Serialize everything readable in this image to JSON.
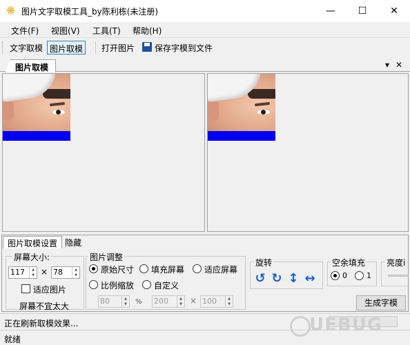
{
  "window": {
    "title": "图片文字取模工具_by陈利栋(未注册)",
    "minimize": "—",
    "maximize": "☐",
    "close": "✕"
  },
  "menu": [
    "文件(F)",
    "视图(V)",
    "工具(T)",
    "帮助(H)"
  ],
  "toolbar": {
    "text_mode": "文字取模",
    "image_mode": "图片取模",
    "open_image": "打开图片",
    "save_to_file": "保存字模到文件"
  },
  "doc_tab": {
    "label": "图片取模",
    "dropdown": "▾",
    "close": "✕"
  },
  "settings_tabs": [
    "图片取模设置",
    "隐藏"
  ],
  "screen_size": {
    "label": "屏幕大小:",
    "width": "117",
    "times": "×",
    "height": "78",
    "fit_image": "适应图片",
    "warning": "屏幕不宜太大"
  },
  "image_adjust": {
    "label": "图片调整",
    "original": "原始尺寸",
    "fill_screen": "填充屏幕",
    "fit_screen": "适应屏幕",
    "scale": "比例缩放",
    "custom": "自定义",
    "scale_value": "80",
    "percent": "%",
    "custom_w": "200",
    "times": "×",
    "custom_h": "100"
  },
  "rotate": {
    "label": "旋转",
    "ccw": "↺",
    "cw": "↻",
    "flip_v": "↕",
    "flip_h": "↔"
  },
  "fill": {
    "label": "空余填充",
    "opt0": "0",
    "opt1": "1"
  },
  "brightness": {
    "label": "亮度i"
  },
  "generate_button": "生成字模",
  "status": {
    "progress": "正在刷新取模效果...",
    "ready": "就绪"
  },
  "watermark": "UEBUG",
  "colors": {
    "accent_blue": "#0000ee",
    "icon_blue": "#1a5fc8"
  }
}
